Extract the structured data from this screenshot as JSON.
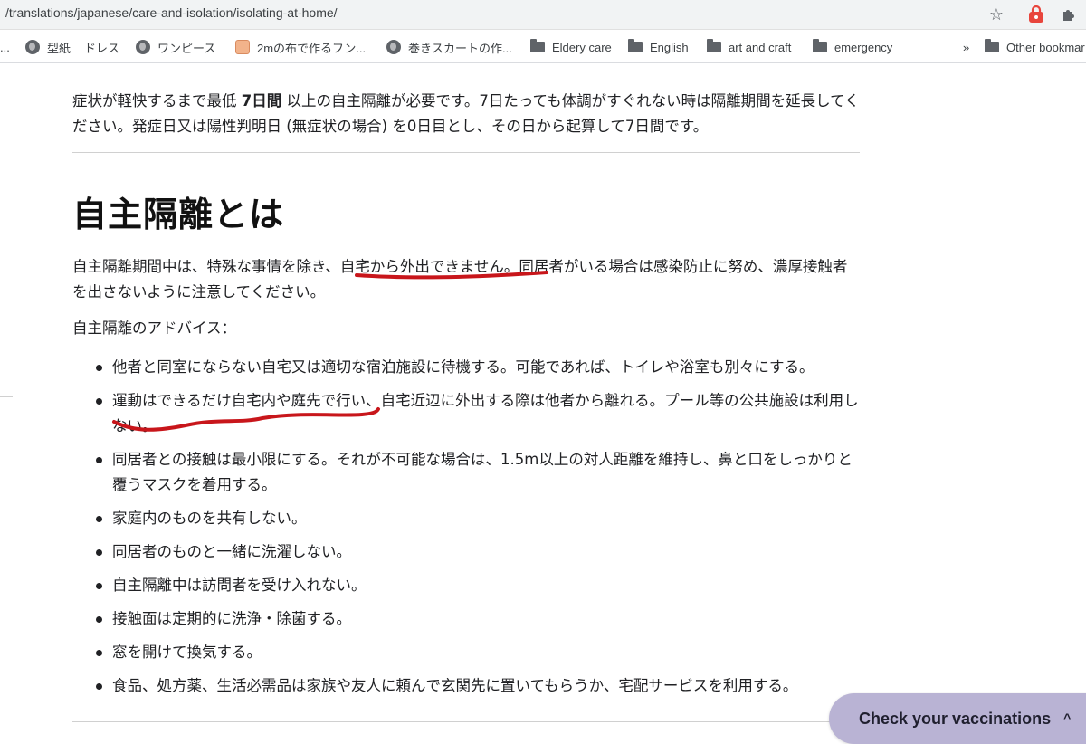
{
  "browser": {
    "url": "/translations/japanese/care-and-isolation/isolating-at-home/",
    "bookmarks": [
      {
        "label": "型紙",
        "icon": "globe-icon"
      },
      {
        "label": "ドレス",
        "icon": "none"
      },
      {
        "label": "ワンピース",
        "icon": "globe-icon"
      },
      {
        "label": "2mの布で作るフン...",
        "icon": "favicon"
      },
      {
        "label": "巻きスカートの作...",
        "icon": "globe-icon"
      },
      {
        "label": "Eldery care",
        "icon": "folder-icon"
      },
      {
        "label": "English",
        "icon": "folder-icon"
      },
      {
        "label": "art and craft",
        "icon": "folder-icon"
      },
      {
        "label": "emergency",
        "icon": "folder-icon"
      },
      {
        "label": "Other bookmar",
        "icon": "folder-icon"
      }
    ],
    "more_label": "»",
    "leading_dots": "..."
  },
  "intro": {
    "part1": "症状が軽快するまで最低 ",
    "bold": "7日間",
    "part2": " 以上の自主隔離が必要です。7日たっても体調がすぐれない時は隔離期間を延長してください。発症日又は陽性判明日 (無症状の場合) を0日目とし、その日から起算して7日間です。"
  },
  "heading": "自主隔離とは",
  "paragraph": "自主隔離期間中は、特殊な事情を除き、自宅から外出できません。同居者がいる場合は感染防止に努め、濃厚接触者を出さないように注意してください。",
  "advice_label": "自主隔離のアドバイス：",
  "advice_items": [
    "他者と同室にならない自宅又は適切な宿泊施設に待機する。可能であれば、トイレや浴室も別々にする。",
    "運動はできるだけ自宅内や庭先で行い、自宅近辺に外出する際は他者から離れる。プール等の公共施設は利用しない。",
    "同居者との接触は最小限にする。それが不可能な場合は、1.5m以上の対人距離を維持し、鼻と口をしっかりと覆うマスクを着用する。",
    "家庭内のものを共有しない。",
    "同居者のものと一緒に洗濯しない。",
    "自主隔離中は訪問者を受け入れない。",
    "接触面は定期的に洗浄・除菌する。",
    "窓を開けて換気する。",
    "食品、処方薬、生活必需品は家族や友人に頼んで玄関先に置いてもらうか、宅配サービスを利用する。"
  ],
  "vaccination_button": {
    "label": "Check your vaccinations",
    "chevron": "^"
  },
  "colors": {
    "annotation_red": "#c8161b",
    "button_bg": "#b9b3d4"
  }
}
